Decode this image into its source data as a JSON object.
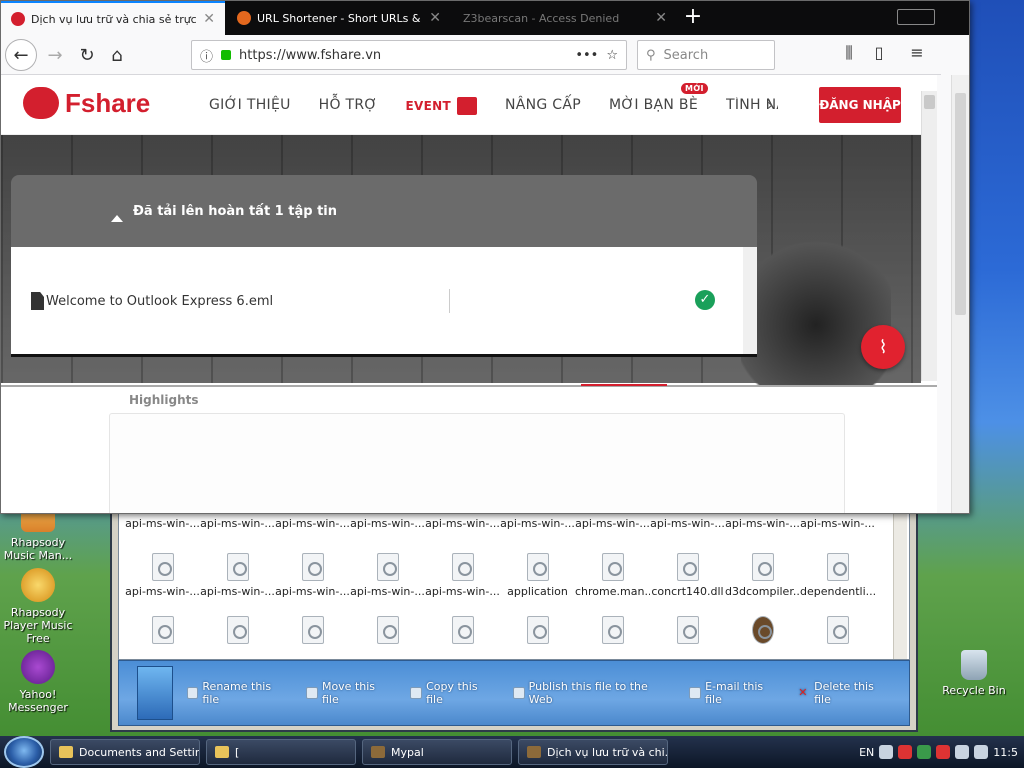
{
  "desktop": {
    "icons": [
      {
        "label": "Recycle Bin"
      },
      {
        "label": "Rhapsody Music Man..."
      },
      {
        "label": "Rhapsody Player Music Free"
      },
      {
        "label": "Yahoo! Messenger"
      }
    ]
  },
  "explorer": {
    "row1": [
      "api-ms-win-...",
      "api-ms-win-...",
      "api-ms-win-...",
      "api-ms-win-...",
      "api-ms-win-...",
      "api-ms-win-...",
      "api-ms-win-...",
      "api-ms-win-...",
      "api-ms-win-...",
      "api-ms-win-..."
    ],
    "row2": [
      "api-ms-win-...",
      "api-ms-win-...",
      "api-ms-win-...",
      "api-ms-win-...",
      "api-ms-win-...",
      "application",
      "chrome.man...",
      "concrt140.dll",
      "d3dcompiler...",
      "dependentli..."
    ],
    "tasks": [
      "Rename this file",
      "Move this file",
      "Copy this file",
      "Publish this file to the Web",
      "E-mail this file",
      "Delete this file"
    ]
  },
  "taskbar": {
    "buttons": [
      "Documents and Settings",
      "[",
      "Mypal",
      "Dịch vụ lưu trữ và chi..."
    ],
    "tray": {
      "lang": "EN",
      "time": "11:5"
    }
  },
  "browser": {
    "tabs": [
      {
        "title": "Dịch vụ lưu trữ và chia sẻ trực tuy...",
        "color": "#d31f2e"
      },
      {
        "title": "URL Shortener - Short URLs & Custo...",
        "color": "#e3681e"
      },
      {
        "title": "Z3bearscan - Access Denied"
      }
    ],
    "url": "https://www.fshare.vn",
    "url_dots": "•••",
    "search_placeholder": "Search"
  },
  "site": {
    "logo": "Fshare",
    "menu": [
      "GIỚI THIỆU",
      "HỖ TRỢ",
      "EVENT",
      "NÂNG CẤP",
      "MỜI BẠN BÈ",
      "TÍNH NĂNG"
    ],
    "new_badge": "MỚI",
    "login": "ĐĂNG NHẬP",
    "upload_status": "Đã tải lên hoàn tất 1 tập tin",
    "uploaded_file": "Welcome to Outlook Express 6.eml",
    "highlights": "Highlights",
    "brand_color": "#d31f2e"
  }
}
